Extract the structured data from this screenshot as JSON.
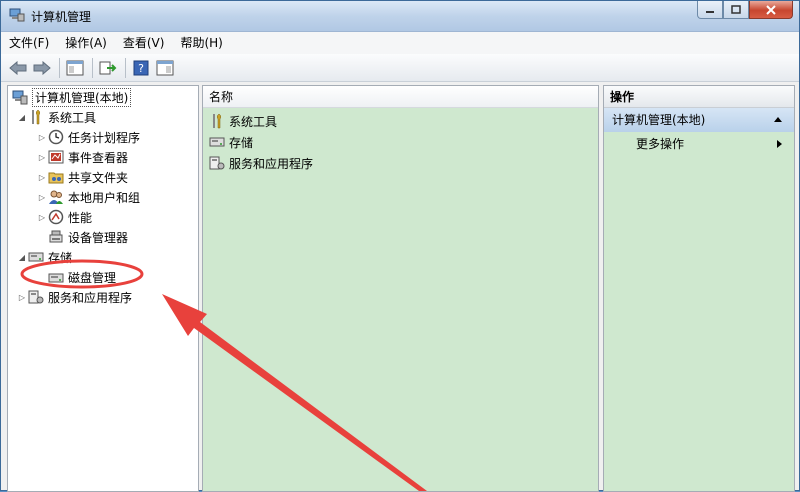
{
  "window": {
    "title": "计算机管理"
  },
  "menu": [
    "文件(F)",
    "操作(A)",
    "查看(V)",
    "帮助(H)"
  ],
  "tree": {
    "root": "计算机管理(本地)",
    "system_tools": "系统工具",
    "system_children": [
      "任务计划程序",
      "事件查看器",
      "共享文件夹",
      "本地用户和组",
      "性能",
      "设备管理器"
    ],
    "storage": "存储",
    "disk_management": "磁盘管理",
    "services": "服务和应用程序"
  },
  "middle": {
    "header": "名称",
    "items": [
      "系统工具",
      "存储",
      "服务和应用程序"
    ]
  },
  "actions": {
    "header": "操作",
    "section": "计算机管理(本地)",
    "more": "更多操作"
  },
  "colors": {
    "pane_green": "#cfe8cf",
    "annotation_red": "#e8413c"
  }
}
